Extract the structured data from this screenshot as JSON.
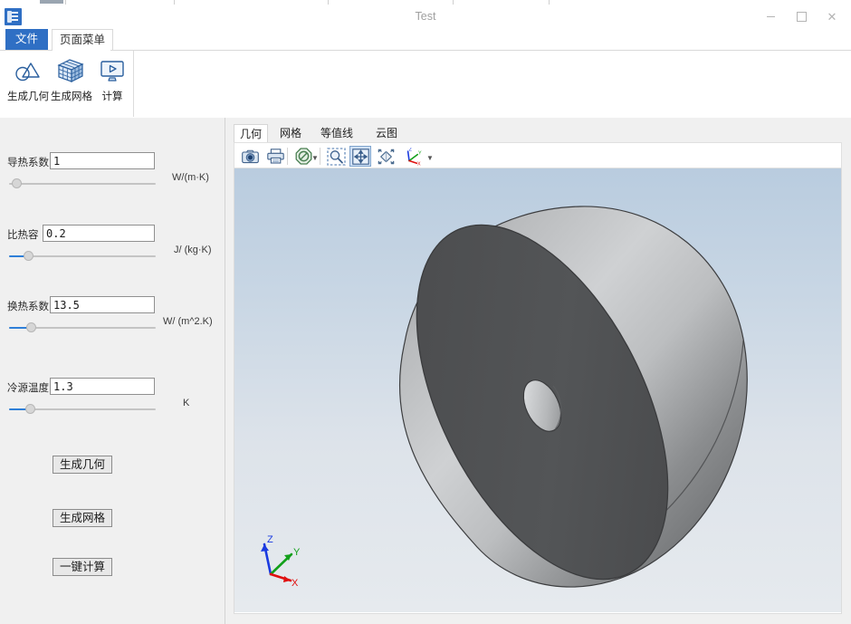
{
  "window": {
    "title": "Test",
    "app_icon": "document-stack-icon",
    "controls": {
      "minimize": "minimize-icon",
      "maximize": "maximize-icon",
      "close": "close-icon"
    }
  },
  "ribbon": {
    "tabs": [
      {
        "label": "文件",
        "active": false,
        "name": "file"
      },
      {
        "label": "页面菜单",
        "active": true,
        "name": "page-menu"
      }
    ],
    "items": [
      {
        "label": "生成几何",
        "icon": "geometry-shapes-icon"
      },
      {
        "label": "生成网格",
        "icon": "mesh-cube-icon"
      },
      {
        "label": "计算",
        "icon": "monitor-run-icon"
      }
    ]
  },
  "parameters": [
    {
      "label": "导热系数",
      "value": "1",
      "unit": "W/(m·K)",
      "slider_percent": 0,
      "name": "thermal-conductivity"
    },
    {
      "label": "比热容",
      "value": "0.2",
      "unit": "J/ (kg·K)",
      "slider_percent": 12,
      "name": "specific-heat"
    },
    {
      "label": "换热系数",
      "value": "13.5",
      "unit": "W/ (m^2.K)",
      "slider_percent": 14,
      "name": "heat-transfer-coefficient"
    },
    {
      "label": "冷源温度",
      "value": "1.3",
      "unit": "K",
      "slider_percent": 13,
      "name": "cold-source-temperature"
    }
  ],
  "panel_buttons": [
    {
      "label": "生成几何",
      "name": "generate-geometry"
    },
    {
      "label": "生成网格",
      "name": "generate-mesh"
    },
    {
      "label": "一键计算",
      "name": "one-click-compute"
    }
  ],
  "viewer": {
    "tabs": [
      {
        "label": "几何",
        "active": true,
        "name": "geometry"
      },
      {
        "label": "网格",
        "active": false,
        "name": "mesh"
      },
      {
        "label": "等值线",
        "active": false,
        "name": "contour"
      },
      {
        "label": "云图",
        "active": false,
        "name": "cloud-map"
      }
    ],
    "toolbar": [
      {
        "icon": "camera-icon",
        "name": "screenshot"
      },
      {
        "icon": "printer-icon",
        "name": "print"
      },
      {
        "icon": "no-entry-icon",
        "name": "clear-selection",
        "has_dropdown": true
      },
      {
        "icon": "zoom-box-icon",
        "name": "zoom-to-box"
      },
      {
        "icon": "pan-move-icon",
        "name": "pan",
        "active": true
      },
      {
        "icon": "rotate-diamond-icon",
        "name": "rotate"
      },
      {
        "icon": "axis-triad-icon",
        "name": "view-orientation",
        "has_dropdown": true
      }
    ],
    "axes": [
      {
        "label": "Z",
        "color": "#1a3ae0"
      },
      {
        "label": "Y",
        "color": "#12a01a"
      },
      {
        "label": "X",
        "color": "#e01010"
      }
    ],
    "model": {
      "description": "hemisphere-dome-with-center-hole",
      "face_color": "#4f5052",
      "dome_light": "#c9cbcd",
      "dome_dark": "#57595b"
    },
    "background": {
      "top": "#b9ccdf",
      "bottom": "#e6eaee"
    }
  },
  "theme": {
    "accent": "#2f6fc4",
    "slider_fill": "#2f7fd8",
    "panel_bg": "#f0f0f0"
  }
}
